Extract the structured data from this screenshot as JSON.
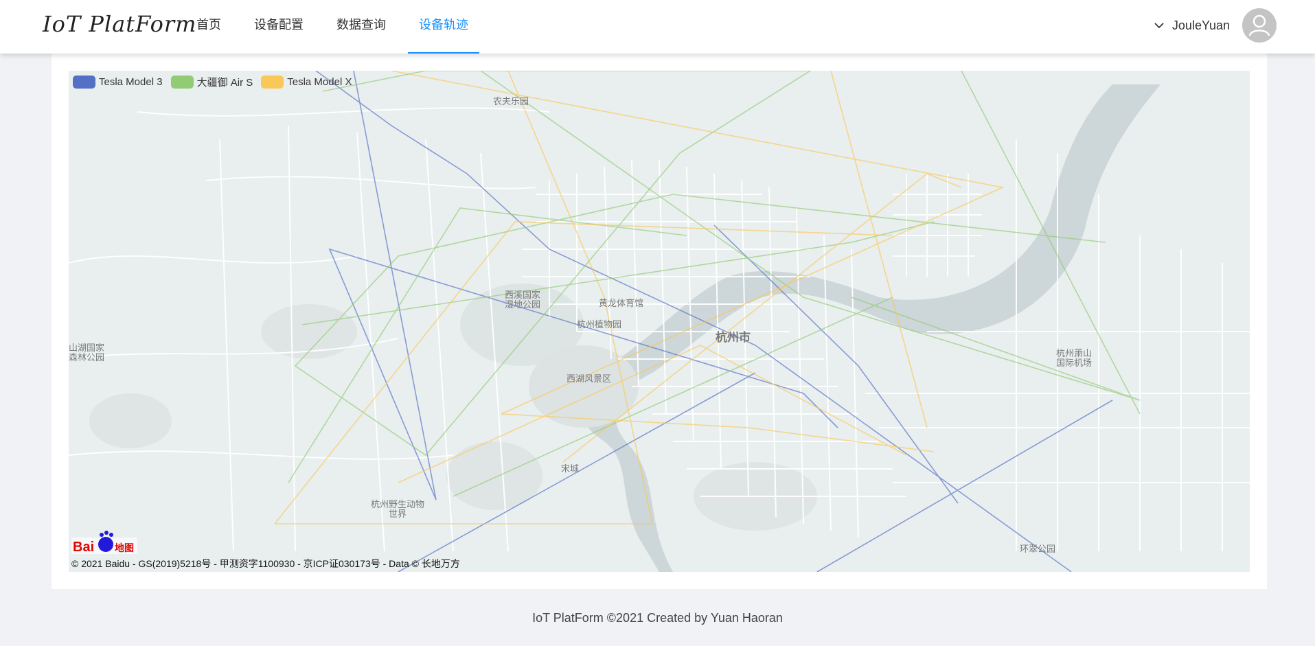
{
  "header": {
    "logo": "IoT PlatForm",
    "nav": [
      {
        "label": "首页"
      },
      {
        "label": "设备配置"
      },
      {
        "label": "数据查询"
      },
      {
        "label": "设备轨迹",
        "active": true
      }
    ],
    "user": {
      "name": "JouleYuan",
      "dropdown_icon": "chevron-down-icon",
      "avatar_icon": "user-avatar-icon"
    }
  },
  "map": {
    "legend": [
      {
        "label": "Tesla Model 3",
        "color": "#5470c6"
      },
      {
        "label": "大疆御 Air S",
        "color": "#91cc75"
      },
      {
        "label": "Tesla Model X",
        "color": "#fac858"
      }
    ],
    "labels": {
      "nongfu": "农夫乐园",
      "xixi": "西溪国家\n湿地公园",
      "huanglong": "黄龙体育馆",
      "botanical": "杭州植物园",
      "hangzhou": "杭州市",
      "xihu": "西湖风景区",
      "songcheng": "宋城",
      "zoo": "杭州野生动物\n世界",
      "forest": "山湖国家\n森林公园",
      "airport": "杭州萧山\n国际机场",
      "huanzhao": "环翠公园"
    },
    "copyright": "© 2021 Baidu - GS(2019)5218号 - 甲测资字1100930 - 京ICP证030173号 - Data © 长地万方",
    "logo_text": "Bai地图"
  },
  "footer": {
    "text": "IoT PlatForm ©2021 Created by Yuan Haoran"
  }
}
